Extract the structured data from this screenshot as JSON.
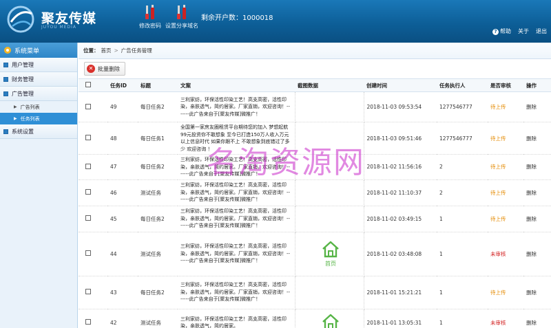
{
  "header": {
    "brand": "聚友传媒",
    "brand_sub": "JUYOU MEDIA",
    "tools": [
      {
        "label": "修改密码",
        "icon": "wrench-screwdriver-icon"
      },
      {
        "label": "设置分享域名",
        "icon": "wrench-screwdriver-icon"
      }
    ],
    "accounts_label": "剩余开户数：",
    "accounts_value": "1000018",
    "links": {
      "help": "帮助",
      "about": "关于",
      "exit": "退出"
    }
  },
  "sidebar": {
    "title": "系统菜单",
    "groups": [
      {
        "label": "用户管理"
      },
      {
        "label": "财务管理"
      },
      {
        "label": "广告管理"
      },
      {
        "label": "系统设置"
      }
    ],
    "subitems": [
      {
        "label": "广告列表",
        "active": false
      },
      {
        "label": "任务列表",
        "active": true
      }
    ]
  },
  "breadcrumb": {
    "prefix": "位置：",
    "home": "首页",
    "sep": ">",
    "current": "广告任务管理"
  },
  "toolbar": {
    "bulk_delete": "批量删除"
  },
  "table": {
    "headers": [
      "",
      "任务ID",
      "标题",
      "文案",
      "截图数据",
      "创建时间",
      "任务执行人",
      "是否审核",
      "操作"
    ],
    "rows": [
      {
        "id": "49",
        "title": "每日任务2",
        "ad": "三利家纺，环保活性印染工艺！高支高密，活性印染，亲肤透气，简约居家。厂家直销，欢迎咨询！-------此广告来自于[聚友传媒]微推广！",
        "shot": "",
        "time": "2018-11-03 09:53:54",
        "exec": "1277546777",
        "status": "待上传",
        "status_type": "wait",
        "op": "删除"
      },
      {
        "id": "48",
        "title": "每日任务1",
        "ad": "全国第一家房友圈租赁平台期待您的加入 梦想起航99元投资你不敢想象 至今已打造150万人收入万元以上信息时代 如果你跟不上 不敢想象到底错过了多少 欢迎咨询 ！",
        "shot": "",
        "time": "2018-11-03 09:51:46",
        "exec": "1277546777",
        "status": "待上传",
        "status_type": "wait",
        "op": "删除"
      },
      {
        "id": "47",
        "title": "每日任务2",
        "ad": "三利家纺，环保活性印染工艺！高支高密，活性印染，亲肤透气，简约居家。厂家直销，欢迎咨询！-------此广告来自于[聚友传媒]微推广！",
        "shot": "",
        "time": "2018-11-02 11:56:16",
        "exec": "2",
        "status": "待上传",
        "status_type": "wait",
        "op": "删除"
      },
      {
        "id": "46",
        "title": "测试任务",
        "ad": "三利家纺，环保活性印染工艺！高支高密，活性印染，亲肤透气，简约居家。厂家直销，欢迎咨询！-------此广告来自于[聚友传媒]微推广！",
        "shot": "",
        "time": "2018-11-02 11:10:37",
        "exec": "2",
        "status": "待上传",
        "status_type": "wait",
        "op": "删除"
      },
      {
        "id": "45",
        "title": "每日任务2",
        "ad": "三利家纺，环保活性印染工艺！高支高密，活性印染，亲肤透气，简约居家。厂家直销，欢迎咨询！-------此广告来自于[聚友传媒]微推广！",
        "shot": "",
        "time": "2018-11-02 03:49:15",
        "exec": "1",
        "status": "待上传",
        "status_type": "wait",
        "op": "删除"
      },
      {
        "id": "44",
        "title": "测试任务",
        "ad": "三利家纺，环保活性印染工艺！高支高密，活性印染，亲肤透气，简约居家。厂家直销，欢迎咨询！-------此广告来自于[聚友传媒]微推广！",
        "shot": "首页",
        "time": "2018-11-02 03:48:08",
        "exec": "1",
        "status": "未审核",
        "status_type": "rej",
        "op": "删除"
      },
      {
        "id": "43",
        "title": "每日任务2",
        "ad": "三利家纺，环保活性印染工艺！高支高密，活性印染，亲肤透气，简约居家。厂家直销，欢迎咨询！-------此广告来自于[聚友传媒]微推广！",
        "shot": "",
        "time": "2018-11-01 15:21:21",
        "exec": "1",
        "status": "待上传",
        "status_type": "wait",
        "op": "删除"
      },
      {
        "id": "42",
        "title": "测试任务",
        "ad": "三利家纺，环保活性印染工艺！高支高密，活性印染，亲肤透气，简约居家。",
        "shot": "house",
        "time": "2018-11-01 13:05:31",
        "exec": "1",
        "status": "未审核",
        "status_type": "rej",
        "op": "删除"
      }
    ]
  },
  "watermark": "名淘资源网",
  "colors": {
    "header": "#0d5f98",
    "wait": "#e48a00",
    "rejected": "#d21e1e",
    "shot_green": "#56b446",
    "active_menu": "#2f8fd6"
  }
}
